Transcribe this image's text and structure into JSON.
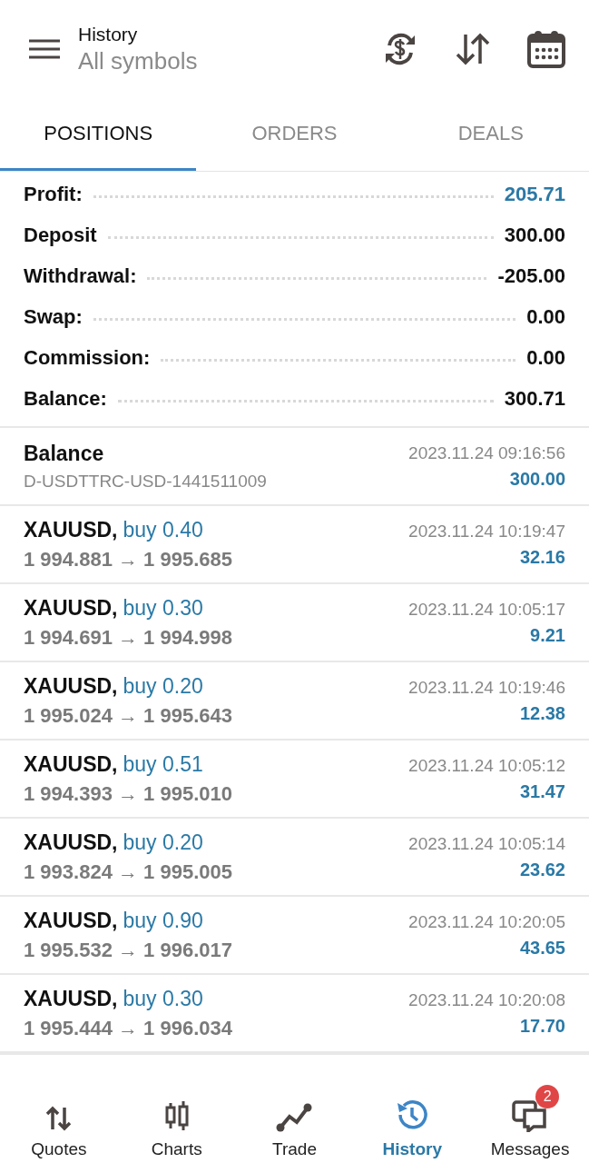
{
  "header": {
    "title": "History",
    "subtitle": "All symbols"
  },
  "tabs": [
    {
      "label": "POSITIONS",
      "selected": true
    },
    {
      "label": "ORDERS",
      "selected": false
    },
    {
      "label": "DEALS",
      "selected": false
    }
  ],
  "summary": [
    {
      "label": "Profit:",
      "value": "205.71",
      "highlight": true
    },
    {
      "label": "Deposit",
      "value": "300.00",
      "highlight": false
    },
    {
      "label": "Withdrawal:",
      "value": "-205.00",
      "highlight": false
    },
    {
      "label": "Swap:",
      "value": "0.00",
      "highlight": false
    },
    {
      "label": "Commission:",
      "value": "0.00",
      "highlight": false
    },
    {
      "label": "Balance:",
      "value": "300.71",
      "highlight": false
    }
  ],
  "records": [
    {
      "kind": "balance",
      "title": "Balance",
      "comment": "D-USDTTRC-USD-1441511009",
      "time": "2023.11.24 09:16:56",
      "amount": "300.00"
    },
    {
      "kind": "trade",
      "symbol": "XAUUSD,",
      "side": "buy 0.40",
      "prices": "1 994.881 → 1 995.685",
      "time": "2023.11.24 10:19:47",
      "amount": "32.16"
    },
    {
      "kind": "trade",
      "symbol": "XAUUSD,",
      "side": "buy 0.30",
      "prices": "1 994.691 → 1 994.998",
      "time": "2023.11.24 10:05:17",
      "amount": "9.21"
    },
    {
      "kind": "trade",
      "symbol": "XAUUSD,",
      "side": "buy 0.20",
      "prices": "1 995.024 → 1 995.643",
      "time": "2023.11.24 10:19:46",
      "amount": "12.38"
    },
    {
      "kind": "trade",
      "symbol": "XAUUSD,",
      "side": "buy 0.51",
      "prices": "1 994.393 → 1 995.010",
      "time": "2023.11.24 10:05:12",
      "amount": "31.47"
    },
    {
      "kind": "trade",
      "symbol": "XAUUSD,",
      "side": "buy 0.20",
      "prices": "1 993.824 → 1 995.005",
      "time": "2023.11.24 10:05:14",
      "amount": "23.62"
    },
    {
      "kind": "trade",
      "symbol": "XAUUSD,",
      "side": "buy 0.90",
      "prices": "1 995.532 → 1 996.017",
      "time": "2023.11.24 10:20:05",
      "amount": "43.65"
    },
    {
      "kind": "trade",
      "symbol": "XAUUSD,",
      "side": "buy 0.30",
      "prices": "1 995.444 → 1 996.034",
      "time": "2023.11.24 10:20:08",
      "amount": "17.70"
    }
  ],
  "nav": [
    {
      "label": "Quotes",
      "selected": false
    },
    {
      "label": "Charts",
      "selected": false
    },
    {
      "label": "Trade",
      "selected": false
    },
    {
      "label": "History",
      "selected": true
    },
    {
      "label": "Messages",
      "selected": false,
      "badge": "2"
    }
  ]
}
